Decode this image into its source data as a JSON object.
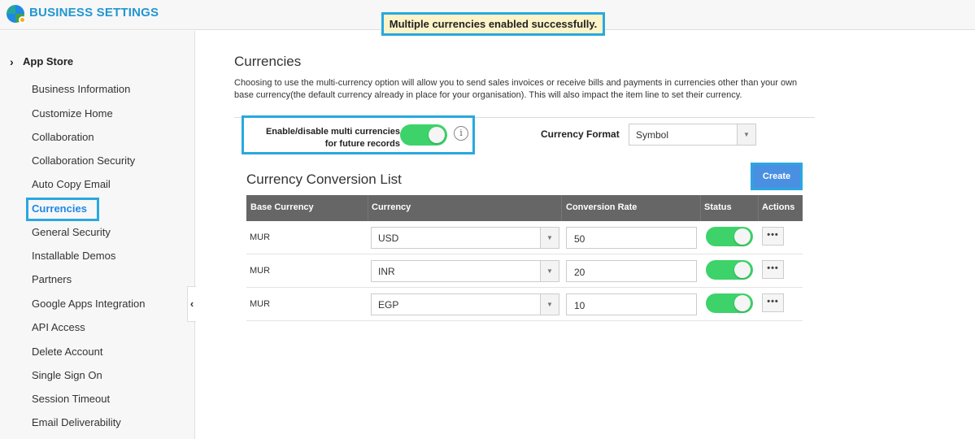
{
  "app": {
    "title": "BUSINESS SETTINGS"
  },
  "toast": {
    "message": "Multiple currencies enabled successfully."
  },
  "sidebar": {
    "heading": "App Store",
    "items": [
      {
        "label": "Business Information"
      },
      {
        "label": "Customize Home"
      },
      {
        "label": "Collaboration"
      },
      {
        "label": "Collaboration Security"
      },
      {
        "label": "Auto Copy Email"
      },
      {
        "label": "Currencies",
        "active": true
      },
      {
        "label": "General Security"
      },
      {
        "label": "Installable Demos"
      },
      {
        "label": "Partners"
      },
      {
        "label": "Google Apps Integration"
      },
      {
        "label": "API Access"
      },
      {
        "label": "Delete Account"
      },
      {
        "label": "Single Sign On"
      },
      {
        "label": "Session Timeout"
      },
      {
        "label": "Email Deliverability"
      }
    ]
  },
  "page": {
    "title": "Currencies",
    "description": "Choosing to use the multi-currency option will allow you to send sales invoices or receive bills and payments in currencies other than your own base currency(the default currency already in place for your organisation). This will also impact the item line to set their currency.",
    "multi_toggle": {
      "label": "Enable/disable multi currencies for future records",
      "on": true
    },
    "currency_format": {
      "label": "Currency Format",
      "value": "Symbol"
    }
  },
  "conversion_list": {
    "title": "Currency Conversion List",
    "create_label": "Create",
    "columns": [
      "Base Currency",
      "Currency",
      "Conversion Rate",
      "Status",
      "Actions"
    ],
    "rows": [
      {
        "base": "MUR",
        "currency": "USD",
        "rate": "50",
        "status_on": true
      },
      {
        "base": "MUR",
        "currency": "INR",
        "rate": "20",
        "status_on": true
      },
      {
        "base": "MUR",
        "currency": "EGP",
        "rate": "10",
        "status_on": true
      }
    ],
    "more_label": "•••"
  },
  "icons": {
    "sidebar_chevron": "chevron-right-icon",
    "collapse": "chevron-left-icon",
    "info": "info-icon",
    "dropdown": "caret-down-icon"
  },
  "colors": {
    "brand": "#2196d3",
    "accent": "#29a8e0",
    "toggle_on": "#3dd36a",
    "create_button": "#4a90e2"
  }
}
